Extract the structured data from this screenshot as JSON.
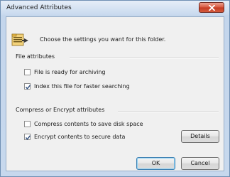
{
  "window": {
    "title": "Advanced Attributes"
  },
  "intro_text": "Choose the settings you want for this folder.",
  "file_attributes": {
    "heading": "File attributes",
    "items": [
      {
        "label": "File is ready for archiving",
        "checked": false
      },
      {
        "label": "Index this file for faster searching",
        "checked": true
      }
    ]
  },
  "compress_encrypt": {
    "heading": "Compress or Encrypt attributes",
    "items": [
      {
        "label": "Compress contents to save disk space",
        "checked": false
      },
      {
        "label": "Encrypt contents to secure data",
        "checked": true
      }
    ]
  },
  "buttons": {
    "details": "Details",
    "ok": "OK",
    "cancel": "Cancel"
  }
}
